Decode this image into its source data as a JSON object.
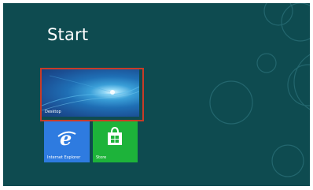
{
  "start_screen": {
    "title": "Start",
    "tiles": [
      {
        "label": "Desktop",
        "icon": "windows-7-wallpaper",
        "color": "#1f6fb5"
      },
      {
        "label": "Internet Explorer",
        "icon": "internet-explorer-icon",
        "color": "#2e7be0"
      },
      {
        "label": "Store",
        "icon": "store-bag-icon",
        "color": "#1db33a"
      }
    ],
    "background_color": "#0e4b50",
    "highlight_color": "#c83b27"
  }
}
